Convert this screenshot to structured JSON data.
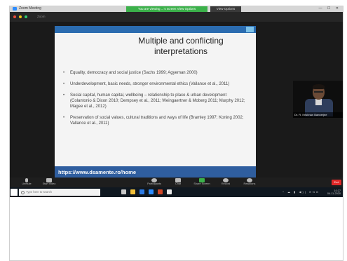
{
  "window": {
    "app_label": "Zoom Meeting",
    "sharing_banner": "You are viewing ...'s screen   View Options",
    "view_options": "View Options",
    "window_controls": "— ☐ ✕"
  },
  "inner_bar": {
    "title": "Zoom"
  },
  "slide": {
    "title": "Multiple and conflicting interpretations",
    "bullets": [
      "Equality, democracy and social justice (Sachs 1999; Agyeman 2000)",
      "Underdevelopment, basic needs, stronger environmental ethics (Vallance et al., 2011)",
      "Social capital, human capital, wellbeing – relationship to place & urban development (Colantonio & Dixon 2010; Dempsey et al., 2011; Weingaertner & Moberg 2011; Murphy 2012; Magee et al., 2012)",
      "Preservation of social values, cultural traditions and ways of life (Bramley 1997; Koning 2002; Vallance et al., 2011)"
    ],
    "footer_url": "https://www.dsamente.ro/home"
  },
  "presenter": {
    "name": "Dr. R. Krishnan Bannerjee"
  },
  "toolbar": {
    "items": [
      {
        "label": "Unmute",
        "icon": "microphone-icon"
      },
      {
        "label": "Start Video",
        "icon": "video-camera-icon"
      },
      {
        "label": "Participants",
        "icon": "participants-icon"
      },
      {
        "label": "Chat",
        "icon": "chat-icon"
      },
      {
        "label": "Share Screen",
        "icon": "share-screen-icon"
      },
      {
        "label": "Record",
        "icon": "record-icon"
      },
      {
        "label": "Reactions",
        "icon": "reactions-icon"
      }
    ],
    "end_label": "End"
  },
  "taskbar": {
    "search_placeholder": "Type here to search",
    "time": "10:27",
    "date": "04-11-2020",
    "tray_text": "^ ☁ ▮ ◀)) ENG"
  },
  "colors": {
    "sharing_green": "#3bb14a",
    "slide_blue": "#2b6cb0",
    "footer_blue": "#2f5e9f",
    "end_red": "#e02828"
  }
}
